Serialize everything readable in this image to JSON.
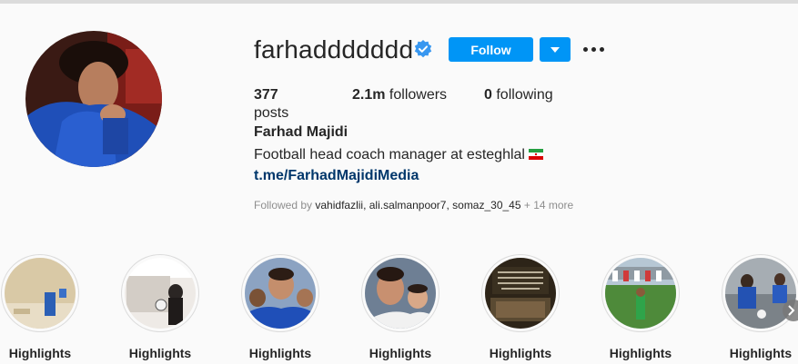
{
  "profile": {
    "username": "farhaddddddd",
    "verified": true,
    "follow_label": "Follow",
    "stats": {
      "posts_count": "377",
      "posts_label": "posts",
      "followers_count": "2.1m",
      "followers_label": "followers",
      "following_count": "0",
      "following_label": "following"
    },
    "full_name": "Farhad Majidi",
    "bio": "Football head coach manager at esteghlal",
    "link": "t.me/FarhadMajidiMedia",
    "followed_by": {
      "prefix": "Followed by ",
      "users": [
        "vahidfazlii",
        "ali.salmanpoor7",
        "somaz_30_45"
      ],
      "suffix": " + 14 more"
    }
  },
  "highlights": [
    {
      "label": "Highlights"
    },
    {
      "label": "Highlights"
    },
    {
      "label": "Highlights"
    },
    {
      "label": "Highlights"
    },
    {
      "label": "Highlights"
    },
    {
      "label": "Highlights"
    },
    {
      "label": "Highlights"
    }
  ],
  "colors": {
    "accent": "#0095f6",
    "link": "#00376b",
    "muted": "#8e8e8e",
    "text": "#262626",
    "background": "#fafafa"
  }
}
